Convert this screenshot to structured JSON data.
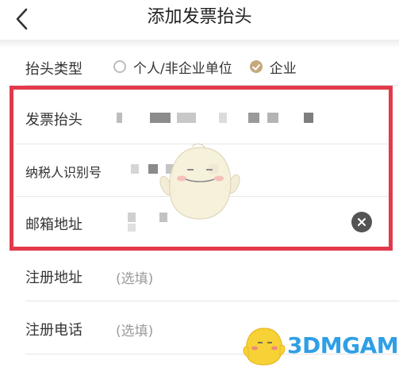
{
  "header": {
    "title": "添加发票抬头",
    "back_icon": "chevron-left-icon"
  },
  "form": {
    "title_type": {
      "label": "抬头类型",
      "options": [
        {
          "label": "个人/非企业单位",
          "checked": false
        },
        {
          "label": "企业",
          "checked": true
        }
      ]
    },
    "invoice_title": {
      "label": "发票抬头",
      "value_obscured": true
    },
    "tax_id": {
      "label": "纳税人识别号",
      "value_obscured": true
    },
    "email": {
      "label": "邮箱地址",
      "value_obscured": true,
      "clear_icon": "clear-icon"
    },
    "register_address": {
      "label": "注册地址",
      "placeholder": "(选填)"
    },
    "register_phone": {
      "label": "注册电话",
      "placeholder": "(选填)"
    }
  },
  "watermark": {
    "text": "3DMGAME"
  },
  "colors": {
    "accent": "#c4a97d",
    "highlight": "#e23a4b",
    "watermark": "#2f9fe6"
  }
}
